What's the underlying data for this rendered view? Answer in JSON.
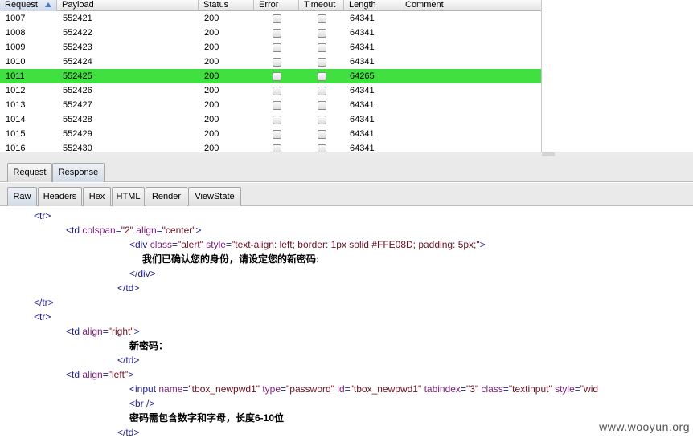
{
  "table": {
    "columns": [
      "Request",
      "Payload",
      "Status",
      "Error",
      "Timeout",
      "Length",
      "Comment"
    ],
    "rows": [
      {
        "request": "1007",
        "payload": "552421",
        "status": "200",
        "length": "64341"
      },
      {
        "request": "1008",
        "payload": "552422",
        "status": "200",
        "length": "64341"
      },
      {
        "request": "1009",
        "payload": "552423",
        "status": "200",
        "length": "64341"
      },
      {
        "request": "1010",
        "payload": "552424",
        "status": "200",
        "length": "64341"
      },
      {
        "request": "1011",
        "payload": "552425",
        "status": "200",
        "length": "64265",
        "highlighted": true
      },
      {
        "request": "1012",
        "payload": "552426",
        "status": "200",
        "length": "64341"
      },
      {
        "request": "1013",
        "payload": "552427",
        "status": "200",
        "length": "64341"
      },
      {
        "request": "1014",
        "payload": "552428",
        "status": "200",
        "length": "64341"
      },
      {
        "request": "1015",
        "payload": "552429",
        "status": "200",
        "length": "64341"
      },
      {
        "request": "1016",
        "payload": "552430",
        "status": "200",
        "length": "64341"
      }
    ],
    "highlight_color": "#40e040"
  },
  "tabs_top": [
    {
      "label": "Request",
      "active": false
    },
    {
      "label": "Response",
      "active": true
    }
  ],
  "tabs_view": [
    {
      "label": "Raw",
      "active": true
    },
    {
      "label": "Headers",
      "active": false
    },
    {
      "label": "Hex",
      "active": false
    },
    {
      "label": "HTML",
      "active": false
    },
    {
      "label": "Render",
      "active": false
    },
    {
      "label": "ViewState",
      "active": false
    }
  ],
  "raw_lines": [
    [
      {
        "c": "tag",
        "t": "<tr>"
      }
    ],
    [
      {
        "c": "tag",
        "t": "<td "
      },
      {
        "c": "attr",
        "t": "colspan"
      },
      {
        "c": "tag",
        "t": "="
      },
      {
        "c": "val",
        "t": "\"2\""
      },
      {
        "c": "tag",
        "t": " "
      },
      {
        "c": "attr",
        "t": "align"
      },
      {
        "c": "tag",
        "t": "="
      },
      {
        "c": "val",
        "t": "\"center\""
      },
      {
        "c": "tag",
        "t": ">"
      }
    ],
    [
      {
        "c": "tag",
        "t": "<div "
      },
      {
        "c": "attr",
        "t": "class"
      },
      {
        "c": "tag",
        "t": "="
      },
      {
        "c": "val",
        "t": "\"alert\""
      },
      {
        "c": "tag",
        "t": " "
      },
      {
        "c": "attr",
        "t": "style"
      },
      {
        "c": "tag",
        "t": "="
      },
      {
        "c": "val",
        "t": "\"text-align: left; border: 1px solid #FFE08D; padding: 5px;\""
      },
      {
        "c": "tag",
        "t": ">"
      }
    ],
    [
      {
        "c": "txt",
        "t": "我们已确认您的身份，请设定您的新密码:"
      }
    ],
    [
      {
        "c": "tag",
        "t": "</div>"
      }
    ],
    [
      {
        "c": "tag",
        "t": "</td>"
      }
    ],
    [
      {
        "c": "tag",
        "t": "</tr>"
      }
    ],
    [
      {
        "c": "tag",
        "t": "<tr>"
      }
    ],
    [
      {
        "c": "tag",
        "t": "<td "
      },
      {
        "c": "attr",
        "t": "align"
      },
      {
        "c": "tag",
        "t": "="
      },
      {
        "c": "val",
        "t": "\"right\""
      },
      {
        "c": "tag",
        "t": ">"
      }
    ],
    [
      {
        "c": "txt",
        "t": "新密码："
      }
    ],
    [
      {
        "c": "tag",
        "t": "</td>"
      }
    ],
    [
      {
        "c": "tag",
        "t": "<td "
      },
      {
        "c": "attr",
        "t": "align"
      },
      {
        "c": "tag",
        "t": "="
      },
      {
        "c": "val",
        "t": "\"left\""
      },
      {
        "c": "tag",
        "t": ">"
      }
    ],
    [
      {
        "c": "tag",
        "t": "<input "
      },
      {
        "c": "attr",
        "t": "name"
      },
      {
        "c": "tag",
        "t": "="
      },
      {
        "c": "val",
        "t": "\"tbox_newpwd1\""
      },
      {
        "c": "tag",
        "t": " "
      },
      {
        "c": "attr",
        "t": "type"
      },
      {
        "c": "tag",
        "t": "="
      },
      {
        "c": "val",
        "t": "\"password\""
      },
      {
        "c": "tag",
        "t": " "
      },
      {
        "c": "attr",
        "t": "id"
      },
      {
        "c": "tag",
        "t": "="
      },
      {
        "c": "val",
        "t": "\"tbox_newpwd1\""
      },
      {
        "c": "tag",
        "t": " "
      },
      {
        "c": "attr",
        "t": "tabindex"
      },
      {
        "c": "tag",
        "t": "="
      },
      {
        "c": "val",
        "t": "\"3\""
      },
      {
        "c": "tag",
        "t": " "
      },
      {
        "c": "attr",
        "t": "class"
      },
      {
        "c": "tag",
        "t": "="
      },
      {
        "c": "val",
        "t": "\"textinput\""
      },
      {
        "c": "tag",
        "t": " "
      },
      {
        "c": "attr",
        "t": "style"
      },
      {
        "c": "tag",
        "t": "="
      },
      {
        "c": "val",
        "t": "\"wid"
      }
    ],
    [
      {
        "c": "tag",
        "t": "<br />"
      }
    ],
    [
      {
        "c": "txt",
        "t": "密码需包含数字和字母，长度6-10位"
      }
    ],
    [
      {
        "c": "tag",
        "t": "</td>"
      }
    ]
  ],
  "watermark": "www.wooyun.org"
}
